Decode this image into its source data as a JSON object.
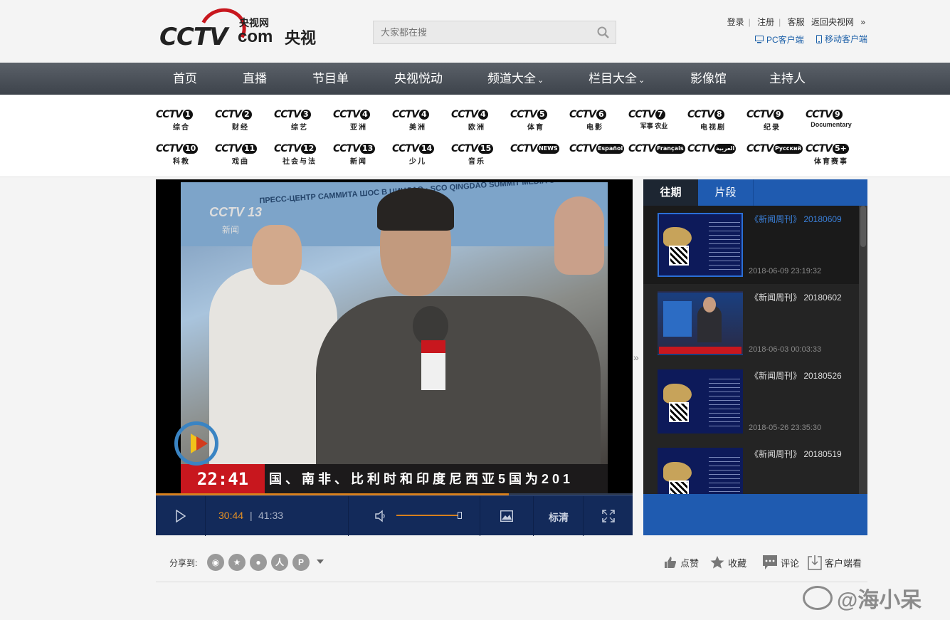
{
  "header": {
    "logo_sub": "央视网",
    "logo_com": "com",
    "logo_cn": "央视",
    "search_placeholder": "大家都在搜",
    "links": [
      "登录",
      "注册",
      "客服"
    ],
    "back_link": "返回央视网",
    "pc_client": "PC客户端",
    "mobile_client": "移动客户端"
  },
  "nav": {
    "items": [
      "首页",
      "直播",
      "节目单",
      "央视悦动",
      "频道大全",
      "栏目大全",
      "影像馆",
      "主持人"
    ]
  },
  "channels": {
    "row1": [
      {
        "num": "1",
        "name": "综合"
      },
      {
        "num": "2",
        "name": "财经"
      },
      {
        "num": "3",
        "name": "综艺"
      },
      {
        "num": "4",
        "name": "亚洲"
      },
      {
        "num": "4",
        "name": "美洲"
      },
      {
        "num": "4",
        "name": "欧洲"
      },
      {
        "num": "5",
        "name": "体育"
      },
      {
        "num": "6",
        "name": "电影"
      },
      {
        "num": "7",
        "name": "军事 农业"
      },
      {
        "num": "8",
        "name": "电视剧"
      },
      {
        "num": "9",
        "name": "纪录"
      },
      {
        "num": "9",
        "name": "Documentary"
      }
    ],
    "row2": [
      {
        "num": "10",
        "name": "科教"
      },
      {
        "num": "11",
        "name": "戏曲"
      },
      {
        "num": "12",
        "name": "社会与法"
      },
      {
        "num": "13",
        "name": "新闻"
      },
      {
        "num": "14",
        "name": "少儿"
      },
      {
        "num": "15",
        "name": "音乐"
      },
      {
        "num": "NEWS",
        "name": ""
      },
      {
        "num": "Español",
        "name": ""
      },
      {
        "num": "Français",
        "name": ""
      },
      {
        "num": "العربية",
        "name": ""
      },
      {
        "num": "Русский",
        "name": ""
      },
      {
        "num": "5+",
        "name": "体育赛事"
      }
    ]
  },
  "player": {
    "video_channel": "CCTV 13",
    "video_channel_sub": "新闻",
    "banner_text": "ПРЕСС-ЦЕНТР САММИТА ШОС В ЦИНДАО · SCO QINGDAO SUMMIT MEDIA C",
    "caption_time": "22:41",
    "caption_text": "国、南非、比利时和印度尼西亚5国为201",
    "current_time": "30:44",
    "total_time": "41:33",
    "separator": "|",
    "quality": "标清",
    "progress_fraction": 0.74,
    "volume_fraction": 0.95
  },
  "playlist": {
    "tabs": [
      "往期",
      "片段"
    ],
    "items": [
      {
        "title": "《新闻周刊》 20180609",
        "date": "2018-06-09 23:19:32",
        "selected": true
      },
      {
        "title": "《新闻周刊》 20180602",
        "date": "2018-06-03 00:03:33",
        "selected": false
      },
      {
        "title": "《新闻周刊》 20180526",
        "date": "2018-05-26 23:35:30",
        "selected": false
      },
      {
        "title": "《新闻周刊》 20180519",
        "date": "",
        "selected": false
      }
    ]
  },
  "share": {
    "label": "分享到:",
    "icons": [
      "weibo-icon",
      "qzone-icon",
      "wechat-icon",
      "renren-icon",
      "pinterest-icon"
    ],
    "actions": [
      "点赞",
      "收藏",
      "评论",
      "客户端看"
    ]
  },
  "watermark": "@海小呆",
  "colors": {
    "accent_blue": "#1f5bb0",
    "brand_red": "#c8171e",
    "progress_orange": "#d7801d"
  }
}
